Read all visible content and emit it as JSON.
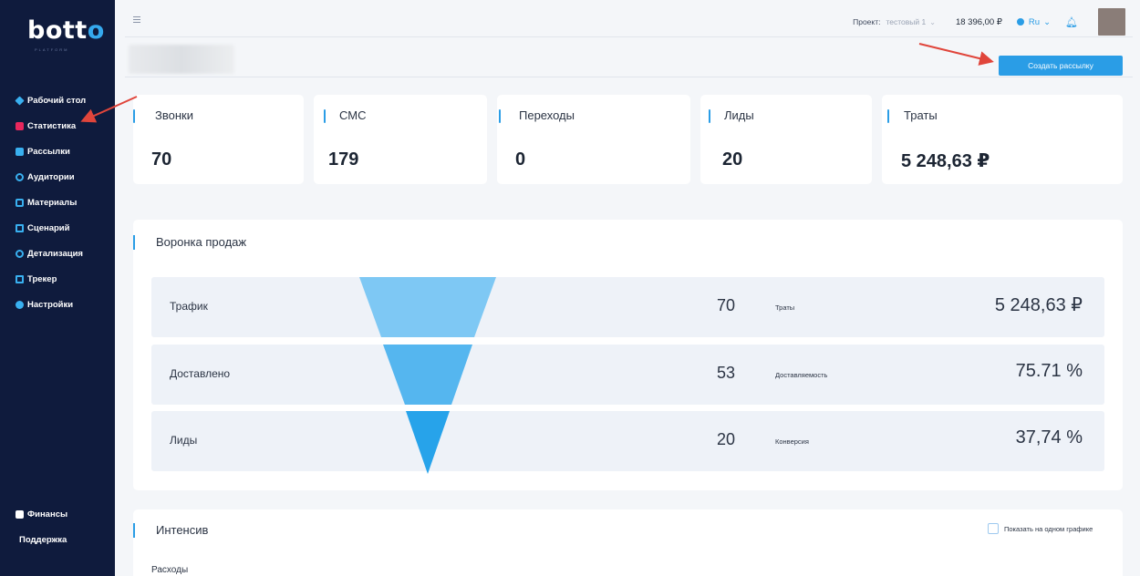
{
  "logo": {
    "text_a": "bott",
    "text_b": "o",
    "sub": "PLATFORM"
  },
  "sidebar": {
    "items": [
      {
        "label": "Рабочий стол",
        "icon": "layers-icon"
      },
      {
        "label": "Статистика",
        "icon": "chart-icon",
        "active": true
      },
      {
        "label": "Рассылки",
        "icon": "mail-icon"
      },
      {
        "label": "Аудитории",
        "icon": "users-icon"
      },
      {
        "label": "Материалы",
        "icon": "folder-icon"
      },
      {
        "label": "Сценарий",
        "icon": "scenario-icon"
      },
      {
        "label": "Детализация",
        "icon": "phone-icon"
      },
      {
        "label": "Трекер",
        "icon": "monitor-icon"
      },
      {
        "label": "Настройки",
        "icon": "gear-icon"
      }
    ],
    "bottom": [
      {
        "label": "Финансы",
        "icon": "wallet-icon"
      },
      {
        "label": "Поддержка"
      }
    ]
  },
  "topbar": {
    "project_label": "Проект:",
    "project_value": "тестовый 1",
    "balance": "18 396,00 ₽",
    "lang": "Ru",
    "bell_icon": "bell-icon"
  },
  "actions": {
    "create_label": "Создать рассылку"
  },
  "stats": [
    {
      "label": "Звонки",
      "value": "70"
    },
    {
      "label": "СМС",
      "value": "179"
    },
    {
      "label": "Переходы",
      "value": "0"
    },
    {
      "label": "Лиды",
      "value": "20"
    },
    {
      "label": "Траты",
      "value": "5 248,63 ₽"
    }
  ],
  "funnel": {
    "title": "Воронка продаж",
    "rows": [
      {
        "label": "Трафик",
        "count": "70",
        "metric": "Траты",
        "metric_value": "5 248,63 ₽"
      },
      {
        "label": "Доставлено",
        "count": "53",
        "metric": "Доставляемость",
        "metric_value": "75.71 %"
      },
      {
        "label": "Лиды",
        "count": "20",
        "metric": "Конверсия",
        "metric_value": "37,74 %"
      }
    ],
    "colors": [
      "#7ec8f4",
      "#55b6ef",
      "#27a3ea"
    ]
  },
  "intensive": {
    "title": "Интенсив",
    "checkbox_label": "Показать на одном графике",
    "costs_label": "Расходы"
  },
  "colors": {
    "sidebar": "#0f1b3d",
    "accent": "#2a9de6",
    "active": "#e8275d",
    "arrow": "#e0453b"
  }
}
